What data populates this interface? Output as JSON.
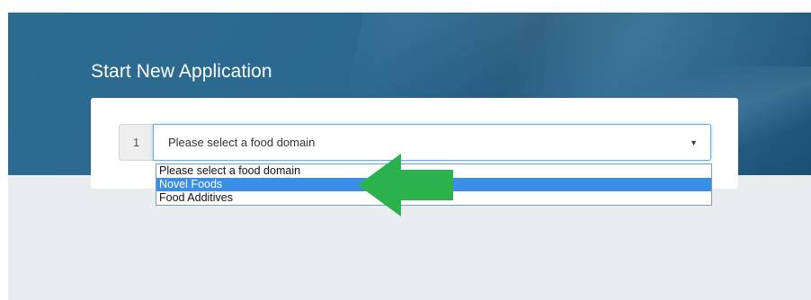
{
  "page": {
    "title": "Start New Application"
  },
  "form": {
    "step_number": "1",
    "food_domain_select": {
      "value": "Please select a food domain",
      "options": [
        "Please select a food domain",
        "Novel Foods",
        "Food Additives"
      ],
      "highlighted_option": "Novel Foods"
    }
  },
  "colors": {
    "hero_blue": "#2a6890",
    "highlight": "#3a8ee6",
    "arrow_green": "#2bb24c",
    "background_gray": "#eaedf0"
  },
  "icons": {
    "caret": "caret-down-icon",
    "annotation": "green-arrow-icon"
  }
}
